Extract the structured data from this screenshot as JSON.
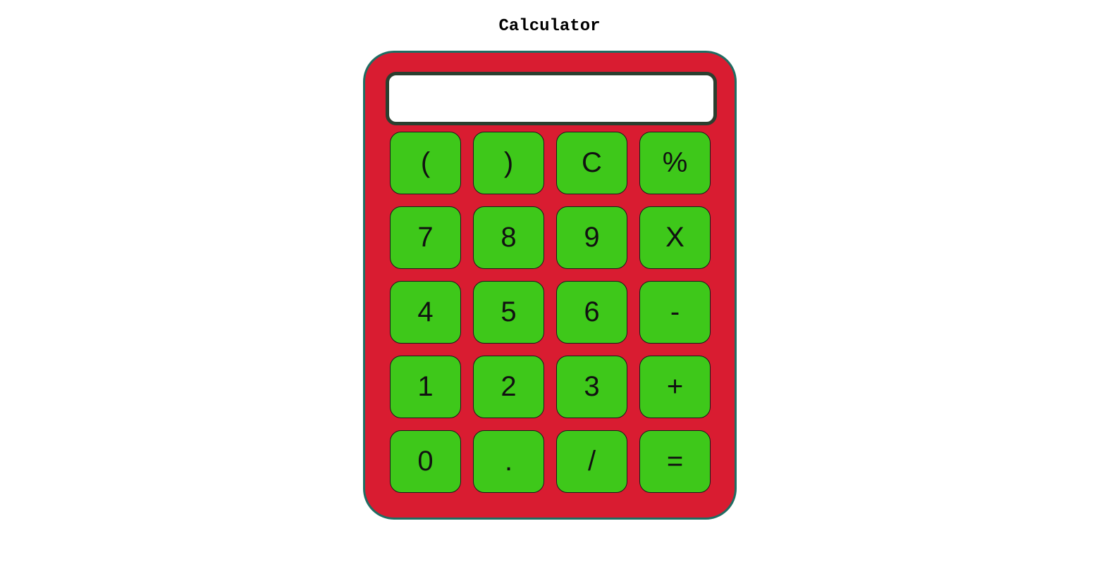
{
  "page": {
    "title": "Calculator"
  },
  "colors": {
    "body": "#d91c31",
    "border": "#1f6e63",
    "key": "#3ec81a",
    "display": "#ffffff",
    "display_border": "#2b3f2f"
  },
  "display": {
    "value": ""
  },
  "keys": [
    {
      "label": "(",
      "name": "open-paren-button"
    },
    {
      "label": ")",
      "name": "close-paren-button"
    },
    {
      "label": "C",
      "name": "clear-button"
    },
    {
      "label": "%",
      "name": "percent-button"
    },
    {
      "label": "7",
      "name": "digit-7-button"
    },
    {
      "label": "8",
      "name": "digit-8-button"
    },
    {
      "label": "9",
      "name": "digit-9-button"
    },
    {
      "label": "X",
      "name": "multiply-button"
    },
    {
      "label": "4",
      "name": "digit-4-button"
    },
    {
      "label": "5",
      "name": "digit-5-button"
    },
    {
      "label": "6",
      "name": "digit-6-button"
    },
    {
      "label": "-",
      "name": "subtract-button"
    },
    {
      "label": "1",
      "name": "digit-1-button"
    },
    {
      "label": "2",
      "name": "digit-2-button"
    },
    {
      "label": "3",
      "name": "digit-3-button"
    },
    {
      "label": "+",
      "name": "add-button"
    },
    {
      "label": "0",
      "name": "digit-0-button"
    },
    {
      "label": ".",
      "name": "decimal-point-button"
    },
    {
      "label": "/",
      "name": "divide-button"
    },
    {
      "label": "=",
      "name": "equals-button"
    }
  ]
}
